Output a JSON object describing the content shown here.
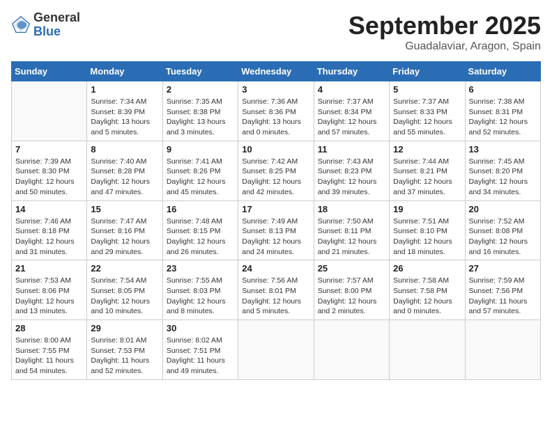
{
  "header": {
    "logo_general": "General",
    "logo_blue": "Blue",
    "month_title": "September 2025",
    "location": "Guadalaviar, Aragon, Spain"
  },
  "days_of_week": [
    "Sunday",
    "Monday",
    "Tuesday",
    "Wednesday",
    "Thursday",
    "Friday",
    "Saturday"
  ],
  "weeks": [
    [
      {
        "day": "",
        "sunrise": "",
        "sunset": "",
        "daylight": ""
      },
      {
        "day": "1",
        "sunrise": "Sunrise: 7:34 AM",
        "sunset": "Sunset: 8:39 PM",
        "daylight": "Daylight: 13 hours and 5 minutes."
      },
      {
        "day": "2",
        "sunrise": "Sunrise: 7:35 AM",
        "sunset": "Sunset: 8:38 PM",
        "daylight": "Daylight: 13 hours and 3 minutes."
      },
      {
        "day": "3",
        "sunrise": "Sunrise: 7:36 AM",
        "sunset": "Sunset: 8:36 PM",
        "daylight": "Daylight: 13 hours and 0 minutes."
      },
      {
        "day": "4",
        "sunrise": "Sunrise: 7:37 AM",
        "sunset": "Sunset: 8:34 PM",
        "daylight": "Daylight: 12 hours and 57 minutes."
      },
      {
        "day": "5",
        "sunrise": "Sunrise: 7:37 AM",
        "sunset": "Sunset: 8:33 PM",
        "daylight": "Daylight: 12 hours and 55 minutes."
      },
      {
        "day": "6",
        "sunrise": "Sunrise: 7:38 AM",
        "sunset": "Sunset: 8:31 PM",
        "daylight": "Daylight: 12 hours and 52 minutes."
      }
    ],
    [
      {
        "day": "7",
        "sunrise": "Sunrise: 7:39 AM",
        "sunset": "Sunset: 8:30 PM",
        "daylight": "Daylight: 12 hours and 50 minutes."
      },
      {
        "day": "8",
        "sunrise": "Sunrise: 7:40 AM",
        "sunset": "Sunset: 8:28 PM",
        "daylight": "Daylight: 12 hours and 47 minutes."
      },
      {
        "day": "9",
        "sunrise": "Sunrise: 7:41 AM",
        "sunset": "Sunset: 8:26 PM",
        "daylight": "Daylight: 12 hours and 45 minutes."
      },
      {
        "day": "10",
        "sunrise": "Sunrise: 7:42 AM",
        "sunset": "Sunset: 8:25 PM",
        "daylight": "Daylight: 12 hours and 42 minutes."
      },
      {
        "day": "11",
        "sunrise": "Sunrise: 7:43 AM",
        "sunset": "Sunset: 8:23 PM",
        "daylight": "Daylight: 12 hours and 39 minutes."
      },
      {
        "day": "12",
        "sunrise": "Sunrise: 7:44 AM",
        "sunset": "Sunset: 8:21 PM",
        "daylight": "Daylight: 12 hours and 37 minutes."
      },
      {
        "day": "13",
        "sunrise": "Sunrise: 7:45 AM",
        "sunset": "Sunset: 8:20 PM",
        "daylight": "Daylight: 12 hours and 34 minutes."
      }
    ],
    [
      {
        "day": "14",
        "sunrise": "Sunrise: 7:46 AM",
        "sunset": "Sunset: 8:18 PM",
        "daylight": "Daylight: 12 hours and 31 minutes."
      },
      {
        "day": "15",
        "sunrise": "Sunrise: 7:47 AM",
        "sunset": "Sunset: 8:16 PM",
        "daylight": "Daylight: 12 hours and 29 minutes."
      },
      {
        "day": "16",
        "sunrise": "Sunrise: 7:48 AM",
        "sunset": "Sunset: 8:15 PM",
        "daylight": "Daylight: 12 hours and 26 minutes."
      },
      {
        "day": "17",
        "sunrise": "Sunrise: 7:49 AM",
        "sunset": "Sunset: 8:13 PM",
        "daylight": "Daylight: 12 hours and 24 minutes."
      },
      {
        "day": "18",
        "sunrise": "Sunrise: 7:50 AM",
        "sunset": "Sunset: 8:11 PM",
        "daylight": "Daylight: 12 hours and 21 minutes."
      },
      {
        "day": "19",
        "sunrise": "Sunrise: 7:51 AM",
        "sunset": "Sunset: 8:10 PM",
        "daylight": "Daylight: 12 hours and 18 minutes."
      },
      {
        "day": "20",
        "sunrise": "Sunrise: 7:52 AM",
        "sunset": "Sunset: 8:08 PM",
        "daylight": "Daylight: 12 hours and 16 minutes."
      }
    ],
    [
      {
        "day": "21",
        "sunrise": "Sunrise: 7:53 AM",
        "sunset": "Sunset: 8:06 PM",
        "daylight": "Daylight: 12 hours and 13 minutes."
      },
      {
        "day": "22",
        "sunrise": "Sunrise: 7:54 AM",
        "sunset": "Sunset: 8:05 PM",
        "daylight": "Daylight: 12 hours and 10 minutes."
      },
      {
        "day": "23",
        "sunrise": "Sunrise: 7:55 AM",
        "sunset": "Sunset: 8:03 PM",
        "daylight": "Daylight: 12 hours and 8 minutes."
      },
      {
        "day": "24",
        "sunrise": "Sunrise: 7:56 AM",
        "sunset": "Sunset: 8:01 PM",
        "daylight": "Daylight: 12 hours and 5 minutes."
      },
      {
        "day": "25",
        "sunrise": "Sunrise: 7:57 AM",
        "sunset": "Sunset: 8:00 PM",
        "daylight": "Daylight: 12 hours and 2 minutes."
      },
      {
        "day": "26",
        "sunrise": "Sunrise: 7:58 AM",
        "sunset": "Sunset: 7:58 PM",
        "daylight": "Daylight: 12 hours and 0 minutes."
      },
      {
        "day": "27",
        "sunrise": "Sunrise: 7:59 AM",
        "sunset": "Sunset: 7:56 PM",
        "daylight": "Daylight: 11 hours and 57 minutes."
      }
    ],
    [
      {
        "day": "28",
        "sunrise": "Sunrise: 8:00 AM",
        "sunset": "Sunset: 7:55 PM",
        "daylight": "Daylight: 11 hours and 54 minutes."
      },
      {
        "day": "29",
        "sunrise": "Sunrise: 8:01 AM",
        "sunset": "Sunset: 7:53 PM",
        "daylight": "Daylight: 11 hours and 52 minutes."
      },
      {
        "day": "30",
        "sunrise": "Sunrise: 8:02 AM",
        "sunset": "Sunset: 7:51 PM",
        "daylight": "Daylight: 11 hours and 49 minutes."
      },
      {
        "day": "",
        "sunrise": "",
        "sunset": "",
        "daylight": ""
      },
      {
        "day": "",
        "sunrise": "",
        "sunset": "",
        "daylight": ""
      },
      {
        "day": "",
        "sunrise": "",
        "sunset": "",
        "daylight": ""
      },
      {
        "day": "",
        "sunrise": "",
        "sunset": "",
        "daylight": ""
      }
    ]
  ]
}
